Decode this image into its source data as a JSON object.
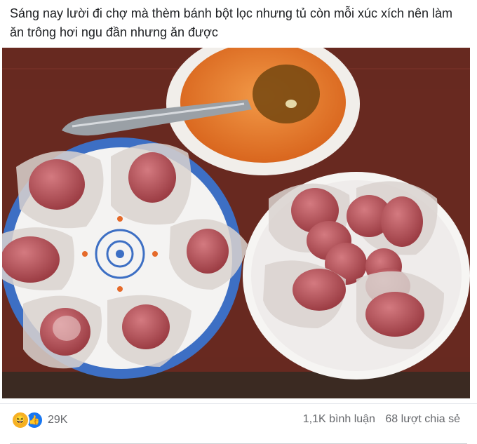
{
  "post": {
    "text": "Sáng nay lười đi chợ mà thèm bánh bột lọc nhưng tủ còn mỗi xúc xích nên làm ăn trông hơi ngu đần nhưng ăn được"
  },
  "photo": {
    "icon": "food-photo"
  },
  "footer": {
    "reaction_icons": [
      "haha-icon",
      "like-icon"
    ],
    "reaction_count": "29K",
    "comments": "1,1K bình luận",
    "shares": "68 lượt chia sẻ"
  },
  "colors": {
    "tray": "#6b2b22",
    "plate_rim": "#3d6fc4",
    "sauce": "#e0782a",
    "sausage": "#b4555a",
    "like_blue": "#1877f2",
    "haha_yellow": "#f7b125"
  }
}
